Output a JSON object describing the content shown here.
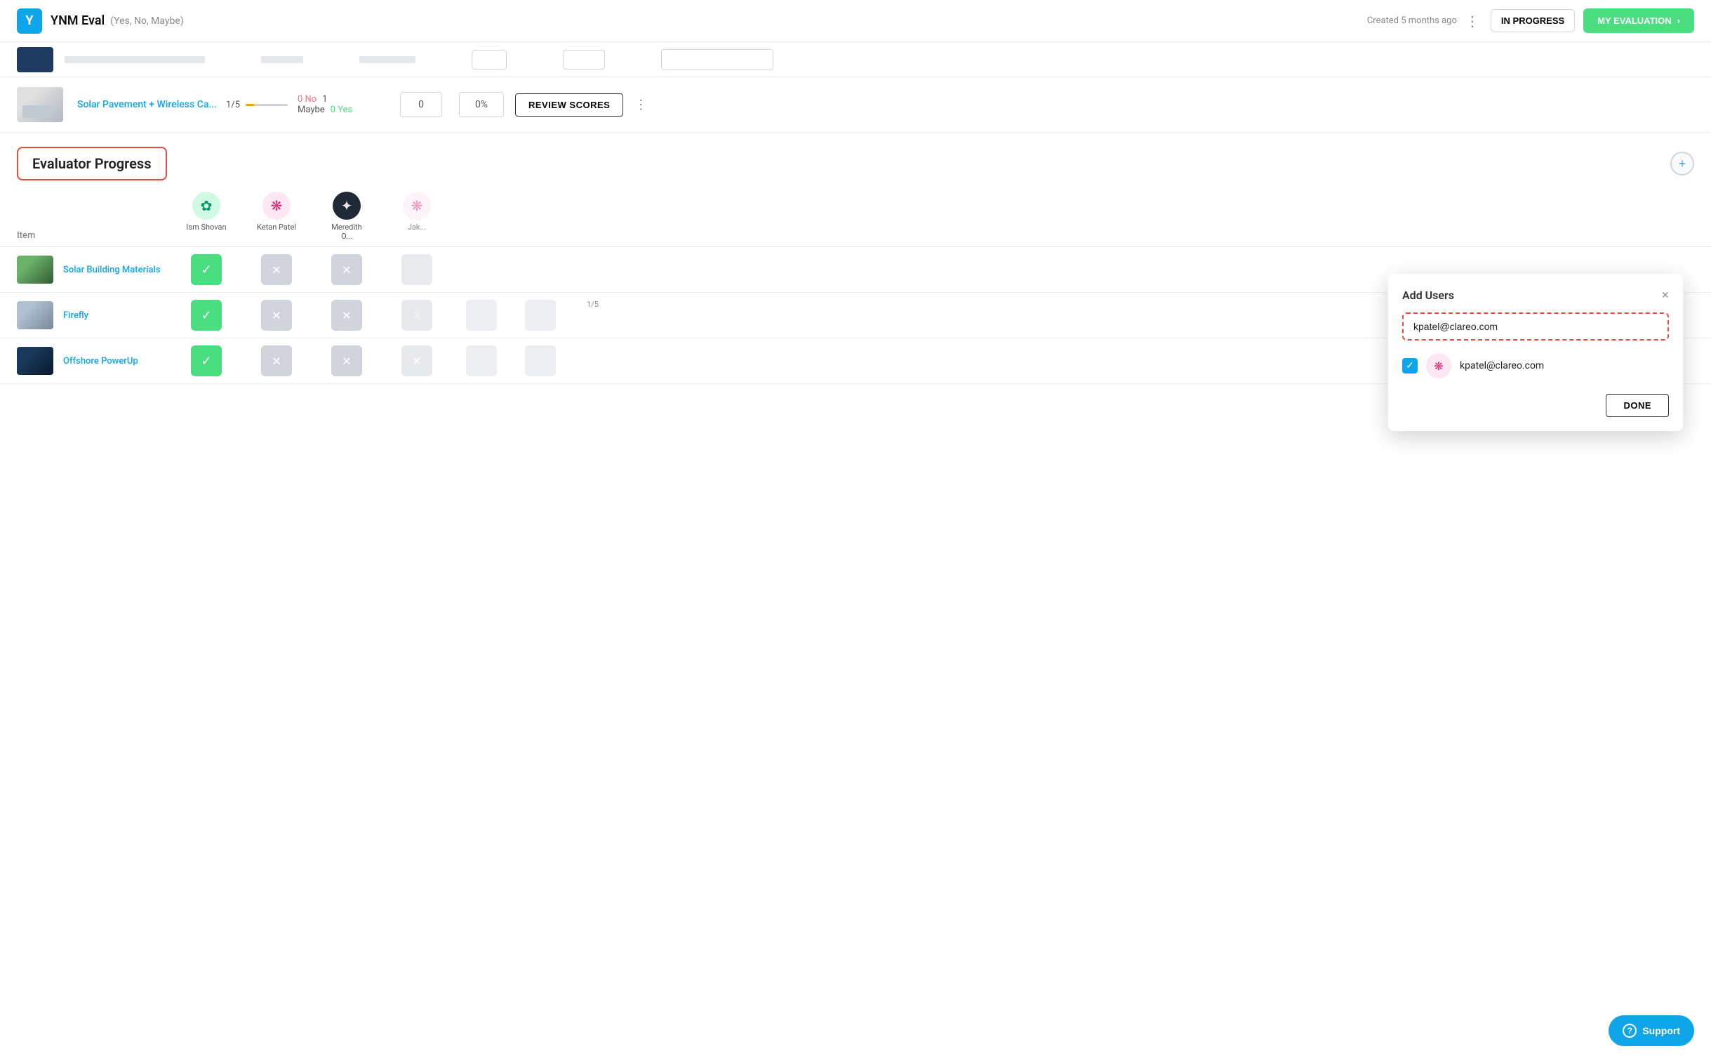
{
  "header": {
    "logo_letter": "Y",
    "title": "YNM Eval",
    "subtitle": "(Yes, No, Maybe)",
    "created": "Created 5 months ago",
    "status_label": "IN PROGRESS",
    "eval_button": "MY EVALUATION"
  },
  "top_partial_row": {
    "thumb_color": "#1e3a5f"
  },
  "solar_pavement_row": {
    "name": "Solar Pavement + Wireless Ca...",
    "progress": "1/5",
    "no_count": "0 No",
    "maybe_count": "1",
    "maybe_label": "Maybe",
    "yes_count": "0 Yes",
    "score": "0",
    "pct": "0%",
    "review_btn": "REVIEW SCORES"
  },
  "evaluator_progress": {
    "title": "Evaluator Progress",
    "add_icon": "+",
    "item_col_label": "Item",
    "users": [
      {
        "name": "Ism Shovan",
        "avatar_type": "green"
      },
      {
        "name": "Ketan Patel",
        "avatar_type": "pink"
      },
      {
        "name": "Meredith O...",
        "avatar_type": "dark"
      },
      {
        "name": "Jak...",
        "avatar_type": "partial"
      }
    ],
    "rows": [
      {
        "name": "Solar Building Materials",
        "thumb_type": "building",
        "statuses": [
          "green",
          "gray",
          "gray",
          "gray"
        ]
      },
      {
        "name": "Firefly",
        "thumb_type": "firefly",
        "statuses": [
          "green",
          "gray",
          "gray",
          "gray"
        ]
      },
      {
        "name": "Offshore PowerUp",
        "thumb_type": "offshore",
        "statuses": [
          "green",
          "gray",
          "gray",
          "gray"
        ]
      }
    ]
  },
  "add_users_modal": {
    "title": "Add Users",
    "close": "×",
    "search_value": "kpatel@clareo.com",
    "user_email": "kpatel@clareo.com",
    "done_btn": "DONE"
  },
  "support_btn": "Support"
}
